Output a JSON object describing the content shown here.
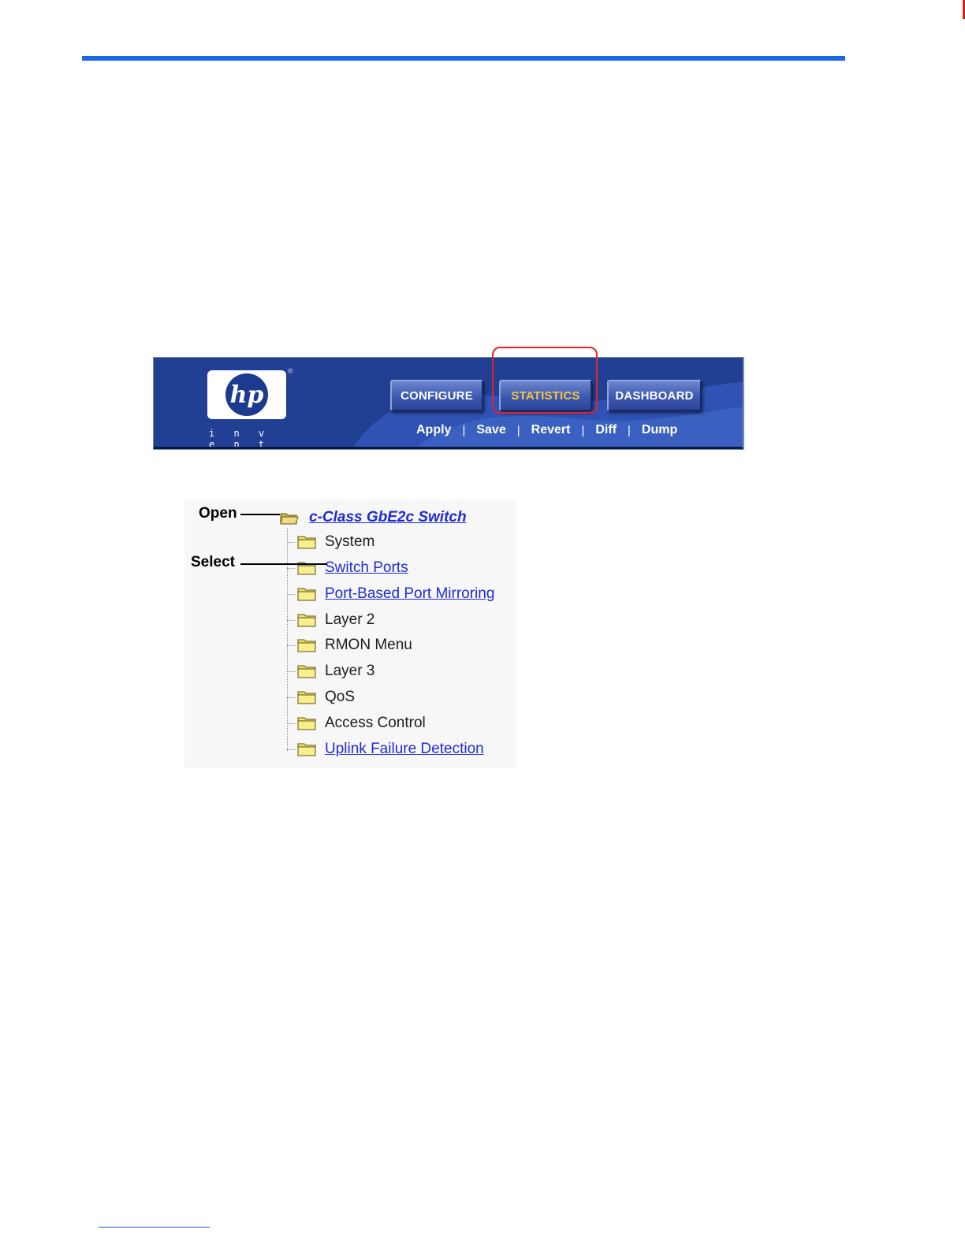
{
  "banner": {
    "logo_text": "hp",
    "logo_registered": "®",
    "tagline": "i n v e n t",
    "nav_buttons": [
      {
        "label": "CONFIGURE",
        "active": false
      },
      {
        "label": "STATISTICS",
        "active": true
      },
      {
        "label": "DASHBOARD",
        "active": false
      }
    ],
    "actions": [
      {
        "label": "Apply"
      },
      {
        "label": "Save"
      },
      {
        "label": "Revert"
      },
      {
        "label": "Diff"
      },
      {
        "label": "Dump"
      }
    ],
    "action_separator": "|"
  },
  "tree": {
    "root": {
      "label": "c-Class GbE2c Switch",
      "link": true
    },
    "items": [
      {
        "label": "System",
        "link": false
      },
      {
        "label": "Switch Ports",
        "link": true
      },
      {
        "label": "Port-Based Port Mirroring",
        "link": true
      },
      {
        "label": "Layer 2",
        "link": false
      },
      {
        "label": "RMON Menu",
        "link": false
      },
      {
        "label": "Layer 3",
        "link": false
      },
      {
        "label": "QoS",
        "link": false
      },
      {
        "label": "Access Control",
        "link": false
      },
      {
        "label": "Uplink Failure Detection",
        "link": true
      }
    ]
  },
  "callouts": {
    "open": "Open",
    "select": "Select"
  },
  "colors": {
    "banner_blue": "#203e92",
    "accent_rule": "#1a66e6",
    "highlight_red": "#e0232d",
    "active_button_text": "#f2c640",
    "link_blue": "#1f2bd8"
  }
}
